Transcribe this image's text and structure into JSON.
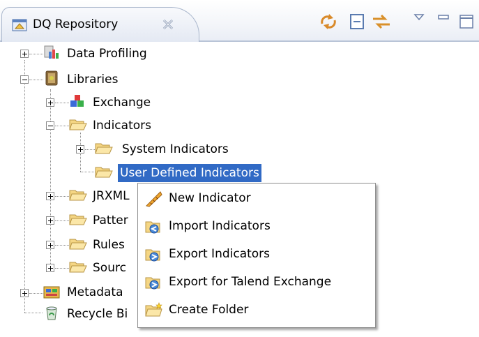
{
  "view": {
    "title": "DQ Repository",
    "toolbar": [
      {
        "name": "refresh-icon"
      },
      {
        "name": "collapse-all-icon"
      },
      {
        "name": "link-with-editor-icon"
      },
      {
        "name": "view-menu-icon"
      },
      {
        "name": "minimize-icon"
      },
      {
        "name": "maximize-icon"
      }
    ]
  },
  "tree": {
    "data_profiling": "Data Profiling",
    "libraries": "Libraries",
    "exchange": "Exchange",
    "indicators": "Indicators",
    "system_indicators": "System Indicators",
    "user_defined_indicators": "User Defined Indicators",
    "jrxml": "JRXML",
    "patterns": "Patter",
    "rules": "Rules",
    "source": "Sourc",
    "metadata": "Metadata",
    "recycle_bin": "Recycle Bi"
  },
  "context_menu": {
    "items": [
      {
        "label": "New Indicator",
        "icon": "new-indicator-icon"
      },
      {
        "label": "Import Indicators",
        "icon": "import-icon"
      },
      {
        "label": "Export Indicators",
        "icon": "export-icon"
      },
      {
        "label": "Export for Talend Exchange",
        "icon": "export-exchange-icon"
      },
      {
        "label": "Create Folder",
        "icon": "create-folder-icon"
      }
    ]
  },
  "colors": {
    "selection": "#316ac5",
    "folder": "#f5d684",
    "folder_border": "#b89545"
  }
}
